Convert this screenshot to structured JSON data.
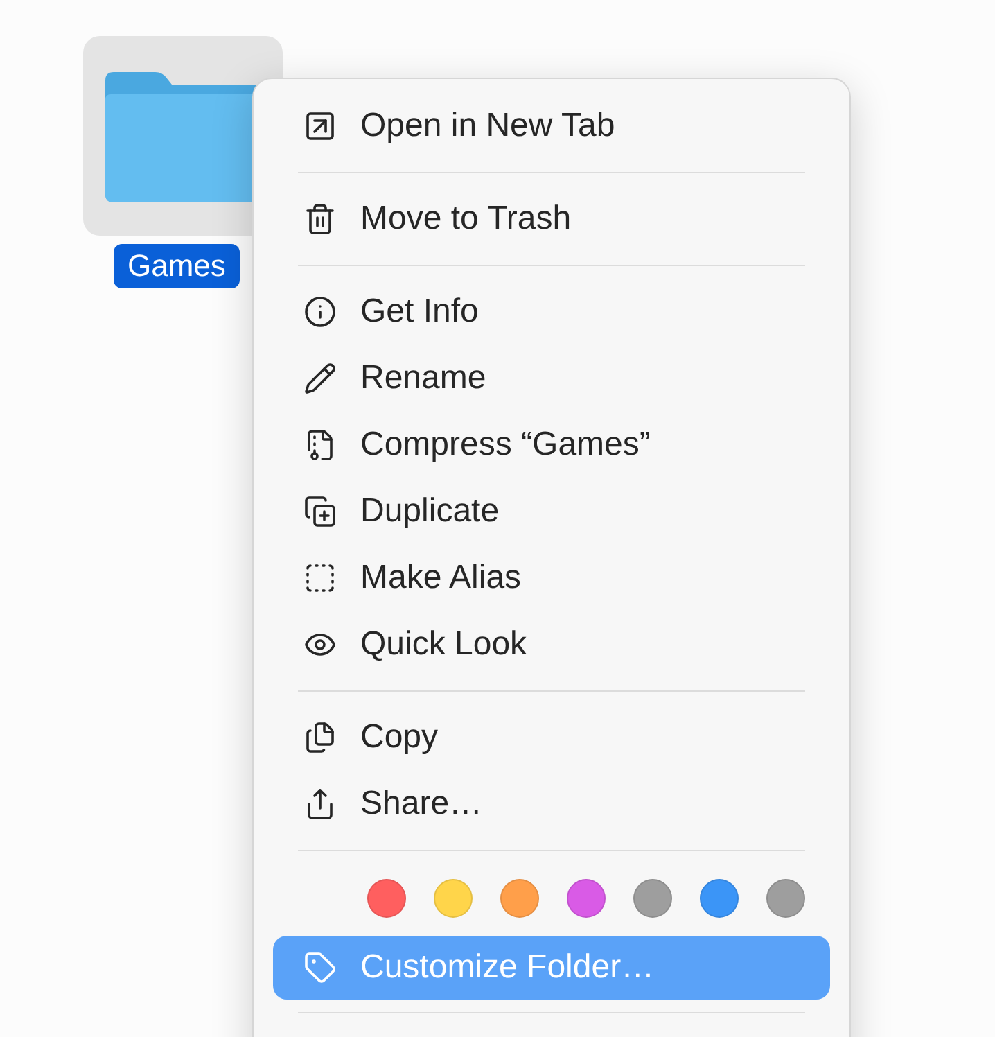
{
  "folder": {
    "name": "Games",
    "selected": true
  },
  "menu": {
    "sections": [
      {
        "items": [
          {
            "label": "Open in New Tab",
            "selected": false
          }
        ]
      },
      {
        "items": [
          {
            "label": "Move to Trash",
            "selected": false
          }
        ]
      },
      {
        "items": [
          {
            "label": "Get Info",
            "selected": false
          },
          {
            "label": "Rename",
            "selected": false
          },
          {
            "label": "Compress “Games”",
            "selected": false
          },
          {
            "label": "Duplicate",
            "selected": false
          },
          {
            "label": "Make Alias",
            "selected": false
          },
          {
            "label": "Quick Look",
            "selected": false
          }
        ]
      },
      {
        "items": [
          {
            "label": "Copy",
            "selected": false
          },
          {
            "label": "Share…",
            "selected": false
          }
        ]
      },
      {
        "tags": [
          {
            "color": "#ff5f5f"
          },
          {
            "color": "#ffd54a"
          },
          {
            "color": "#ff9f4a"
          },
          {
            "color": "#d95be6"
          },
          {
            "color": "#9e9e9e"
          },
          {
            "color": "#3b95f7"
          },
          {
            "color": "#9e9e9e"
          }
        ],
        "items": [
          {
            "label": "Customize Folder…",
            "selected": true
          }
        ]
      }
    ]
  }
}
